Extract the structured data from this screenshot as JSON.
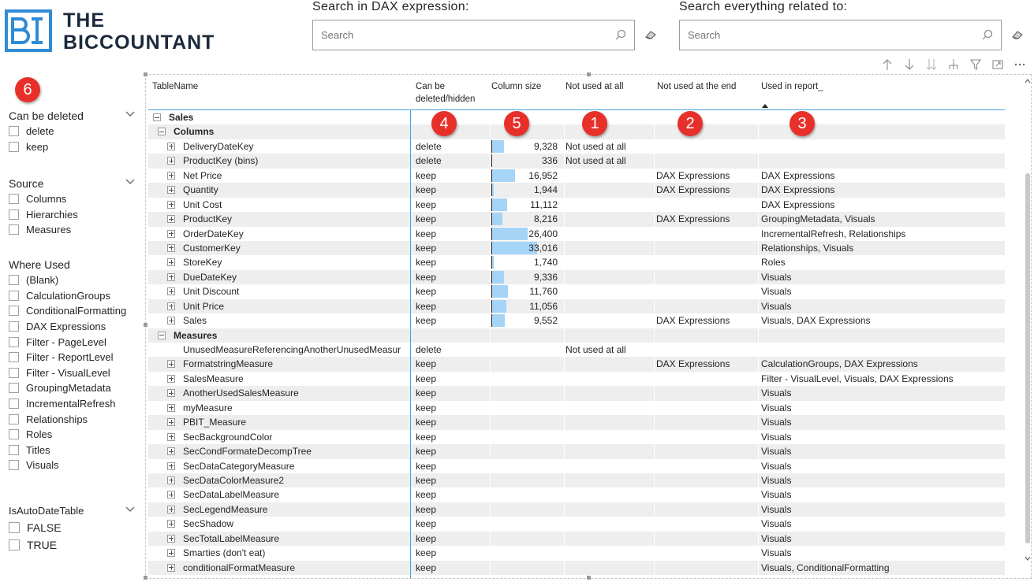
{
  "brand": {
    "line1": "THE",
    "line2": "BICCOUNTANT",
    "color": "#1b2a3a",
    "accent": "#2e8bd6"
  },
  "search_dax": {
    "title": "Search in DAX expression:",
    "placeholder": "Search"
  },
  "search_all": {
    "title": "Search everything related to:",
    "placeholder": "Search"
  },
  "badges": [
    "1",
    "2",
    "3",
    "4",
    "5",
    "6"
  ],
  "badge_color": "#e8302b",
  "filters": [
    {
      "title": "Can be deleted",
      "items": [
        "delete",
        "keep"
      ]
    },
    {
      "title": "Source",
      "items": [
        "Columns",
        "Hierarchies",
        "Measures"
      ]
    },
    {
      "title": "Where Used",
      "items": [
        "(Blank)",
        "CalculationGroups",
        "ConditionalFormatting",
        "DAX Expressions",
        "Filter - PageLevel",
        "Filter - ReportLevel",
        "Filter - VisualLevel",
        "GroupingMetadata",
        "IncrementalRefresh",
        "Relationships",
        "Roles",
        "Titles",
        "Visuals"
      ]
    },
    {
      "title": "IsAutoDateTable",
      "items": [
        "FALSE",
        "TRUE"
      ]
    }
  ],
  "table": {
    "headers": {
      "name": "TableName",
      "deleted_line1": "Can be",
      "deleted_line2": "deleted/hidden",
      "size": "Column size",
      "not_used": "Not used at all",
      "not_used_end": "Not used at the end",
      "used_in_report": "Used in report_"
    },
    "max_size": 33016,
    "rows": [
      {
        "level": 0,
        "name": "Sales",
        "group": true,
        "expander": "minus"
      },
      {
        "level": 1,
        "name": "Columns",
        "group": true,
        "expander": "minus"
      },
      {
        "level": 2,
        "name": "DeliveryDateKey",
        "del": "delete",
        "size": 9328,
        "size_label": "9,328",
        "nu": "Not used at all",
        "nue": "",
        "ur": ""
      },
      {
        "level": 2,
        "name": "ProductKey (bins)",
        "del": "delete",
        "size": 336,
        "size_label": "336",
        "nu": "Not used at all",
        "nue": "",
        "ur": ""
      },
      {
        "level": 2,
        "name": "Net Price",
        "del": "keep",
        "size": 16952,
        "size_label": "16,952",
        "nu": "",
        "nue": "DAX Expressions",
        "ur": "DAX Expressions"
      },
      {
        "level": 2,
        "name": "Quantity",
        "del": "keep",
        "size": 1944,
        "size_label": "1,944",
        "nu": "",
        "nue": "DAX Expressions",
        "ur": "DAX Expressions"
      },
      {
        "level": 2,
        "name": "Unit Cost",
        "del": "keep",
        "size": 11112,
        "size_label": "11,112",
        "nu": "",
        "nue": "",
        "ur": "DAX Expressions"
      },
      {
        "level": 2,
        "name": "ProductKey",
        "del": "keep",
        "size": 8216,
        "size_label": "8,216",
        "nu": "",
        "nue": "DAX Expressions",
        "ur": "GroupingMetadata, Visuals"
      },
      {
        "level": 2,
        "name": "OrderDateKey",
        "del": "keep",
        "size": 26400,
        "size_label": "26,400",
        "nu": "",
        "nue": "",
        "ur": "IncrementalRefresh, Relationships"
      },
      {
        "level": 2,
        "name": "CustomerKey",
        "del": "keep",
        "size": 33016,
        "size_label": "33,016",
        "nu": "",
        "nue": "",
        "ur": "Relationships, Visuals"
      },
      {
        "level": 2,
        "name": "StoreKey",
        "del": "keep",
        "size": 1740,
        "size_label": "1,740",
        "nu": "",
        "nue": "",
        "ur": "Roles"
      },
      {
        "level": 2,
        "name": "DueDateKey",
        "del": "keep",
        "size": 9336,
        "size_label": "9,336",
        "nu": "",
        "nue": "",
        "ur": "Visuals"
      },
      {
        "level": 2,
        "name": "Unit Discount",
        "del": "keep",
        "size": 11760,
        "size_label": "11,760",
        "nu": "",
        "nue": "",
        "ur": "Visuals"
      },
      {
        "level": 2,
        "name": "Unit Price",
        "del": "keep",
        "size": 11056,
        "size_label": "11,056",
        "nu": "",
        "nue": "",
        "ur": "Visuals"
      },
      {
        "level": 2,
        "name": "Sales",
        "del": "keep",
        "size": 9552,
        "size_label": "9,552",
        "nu": "",
        "nue": "DAX Expressions",
        "ur": "Visuals, DAX Expressions"
      },
      {
        "level": 1,
        "name": "Measures",
        "group": true,
        "expander": "minus"
      },
      {
        "level": 2,
        "name": "UnusedMeasureReferencingAnotherUnusedMeasur",
        "del": "delete",
        "nu": "Not used at all",
        "nue": "",
        "ur": "",
        "no_expander": true
      },
      {
        "level": 2,
        "name": "FormatstringMeasure",
        "del": "keep",
        "nu": "",
        "nue": "DAX Expressions",
        "ur": "CalculationGroups, DAX Expressions"
      },
      {
        "level": 2,
        "name": "SalesMeasure",
        "del": "keep",
        "nu": "",
        "nue": "",
        "ur": "Filter - VisualLevel, Visuals, DAX Expressions"
      },
      {
        "level": 2,
        "name": "AnotherUsedSalesMeasure",
        "del": "keep",
        "nu": "",
        "nue": "",
        "ur": "Visuals"
      },
      {
        "level": 2,
        "name": "myMeasure",
        "del": "keep",
        "nu": "",
        "nue": "",
        "ur": "Visuals"
      },
      {
        "level": 2,
        "name": "PBIT_Measure",
        "del": "keep",
        "nu": "",
        "nue": "",
        "ur": "Visuals"
      },
      {
        "level": 2,
        "name": "SecBackgroundColor",
        "del": "keep",
        "nu": "",
        "nue": "",
        "ur": "Visuals"
      },
      {
        "level": 2,
        "name": "SecCondFormateDecompTree",
        "del": "keep",
        "nu": "",
        "nue": "",
        "ur": "Visuals"
      },
      {
        "level": 2,
        "name": "SecDataCategoryMeasure",
        "del": "keep",
        "nu": "",
        "nue": "",
        "ur": "Visuals"
      },
      {
        "level": 2,
        "name": "SecDataColorMeasure2",
        "del": "keep",
        "nu": "",
        "nue": "",
        "ur": "Visuals"
      },
      {
        "level": 2,
        "name": "SecDataLabelMeasure",
        "del": "keep",
        "nu": "",
        "nue": "",
        "ur": "Visuals"
      },
      {
        "level": 2,
        "name": "SecLegendMeasure",
        "del": "keep",
        "nu": "",
        "nue": "",
        "ur": "Visuals"
      },
      {
        "level": 2,
        "name": "SecShadow",
        "del": "keep",
        "nu": "",
        "nue": "",
        "ur": "Visuals"
      },
      {
        "level": 2,
        "name": "SecTotalLabelMeasure",
        "del": "keep",
        "nu": "",
        "nue": "",
        "ur": "Visuals"
      },
      {
        "level": 2,
        "name": "Smarties (don't eat)",
        "del": "keep",
        "nu": "",
        "nue": "",
        "ur": "Visuals"
      },
      {
        "level": 2,
        "name": "conditionalFormatMeasure",
        "del": "keep",
        "nu": "",
        "nue": "",
        "ur": "Visuals, ConditionalFormatting"
      }
    ]
  },
  "bar_color": "#a6d4f7",
  "header_line_color": "#3da3e0"
}
